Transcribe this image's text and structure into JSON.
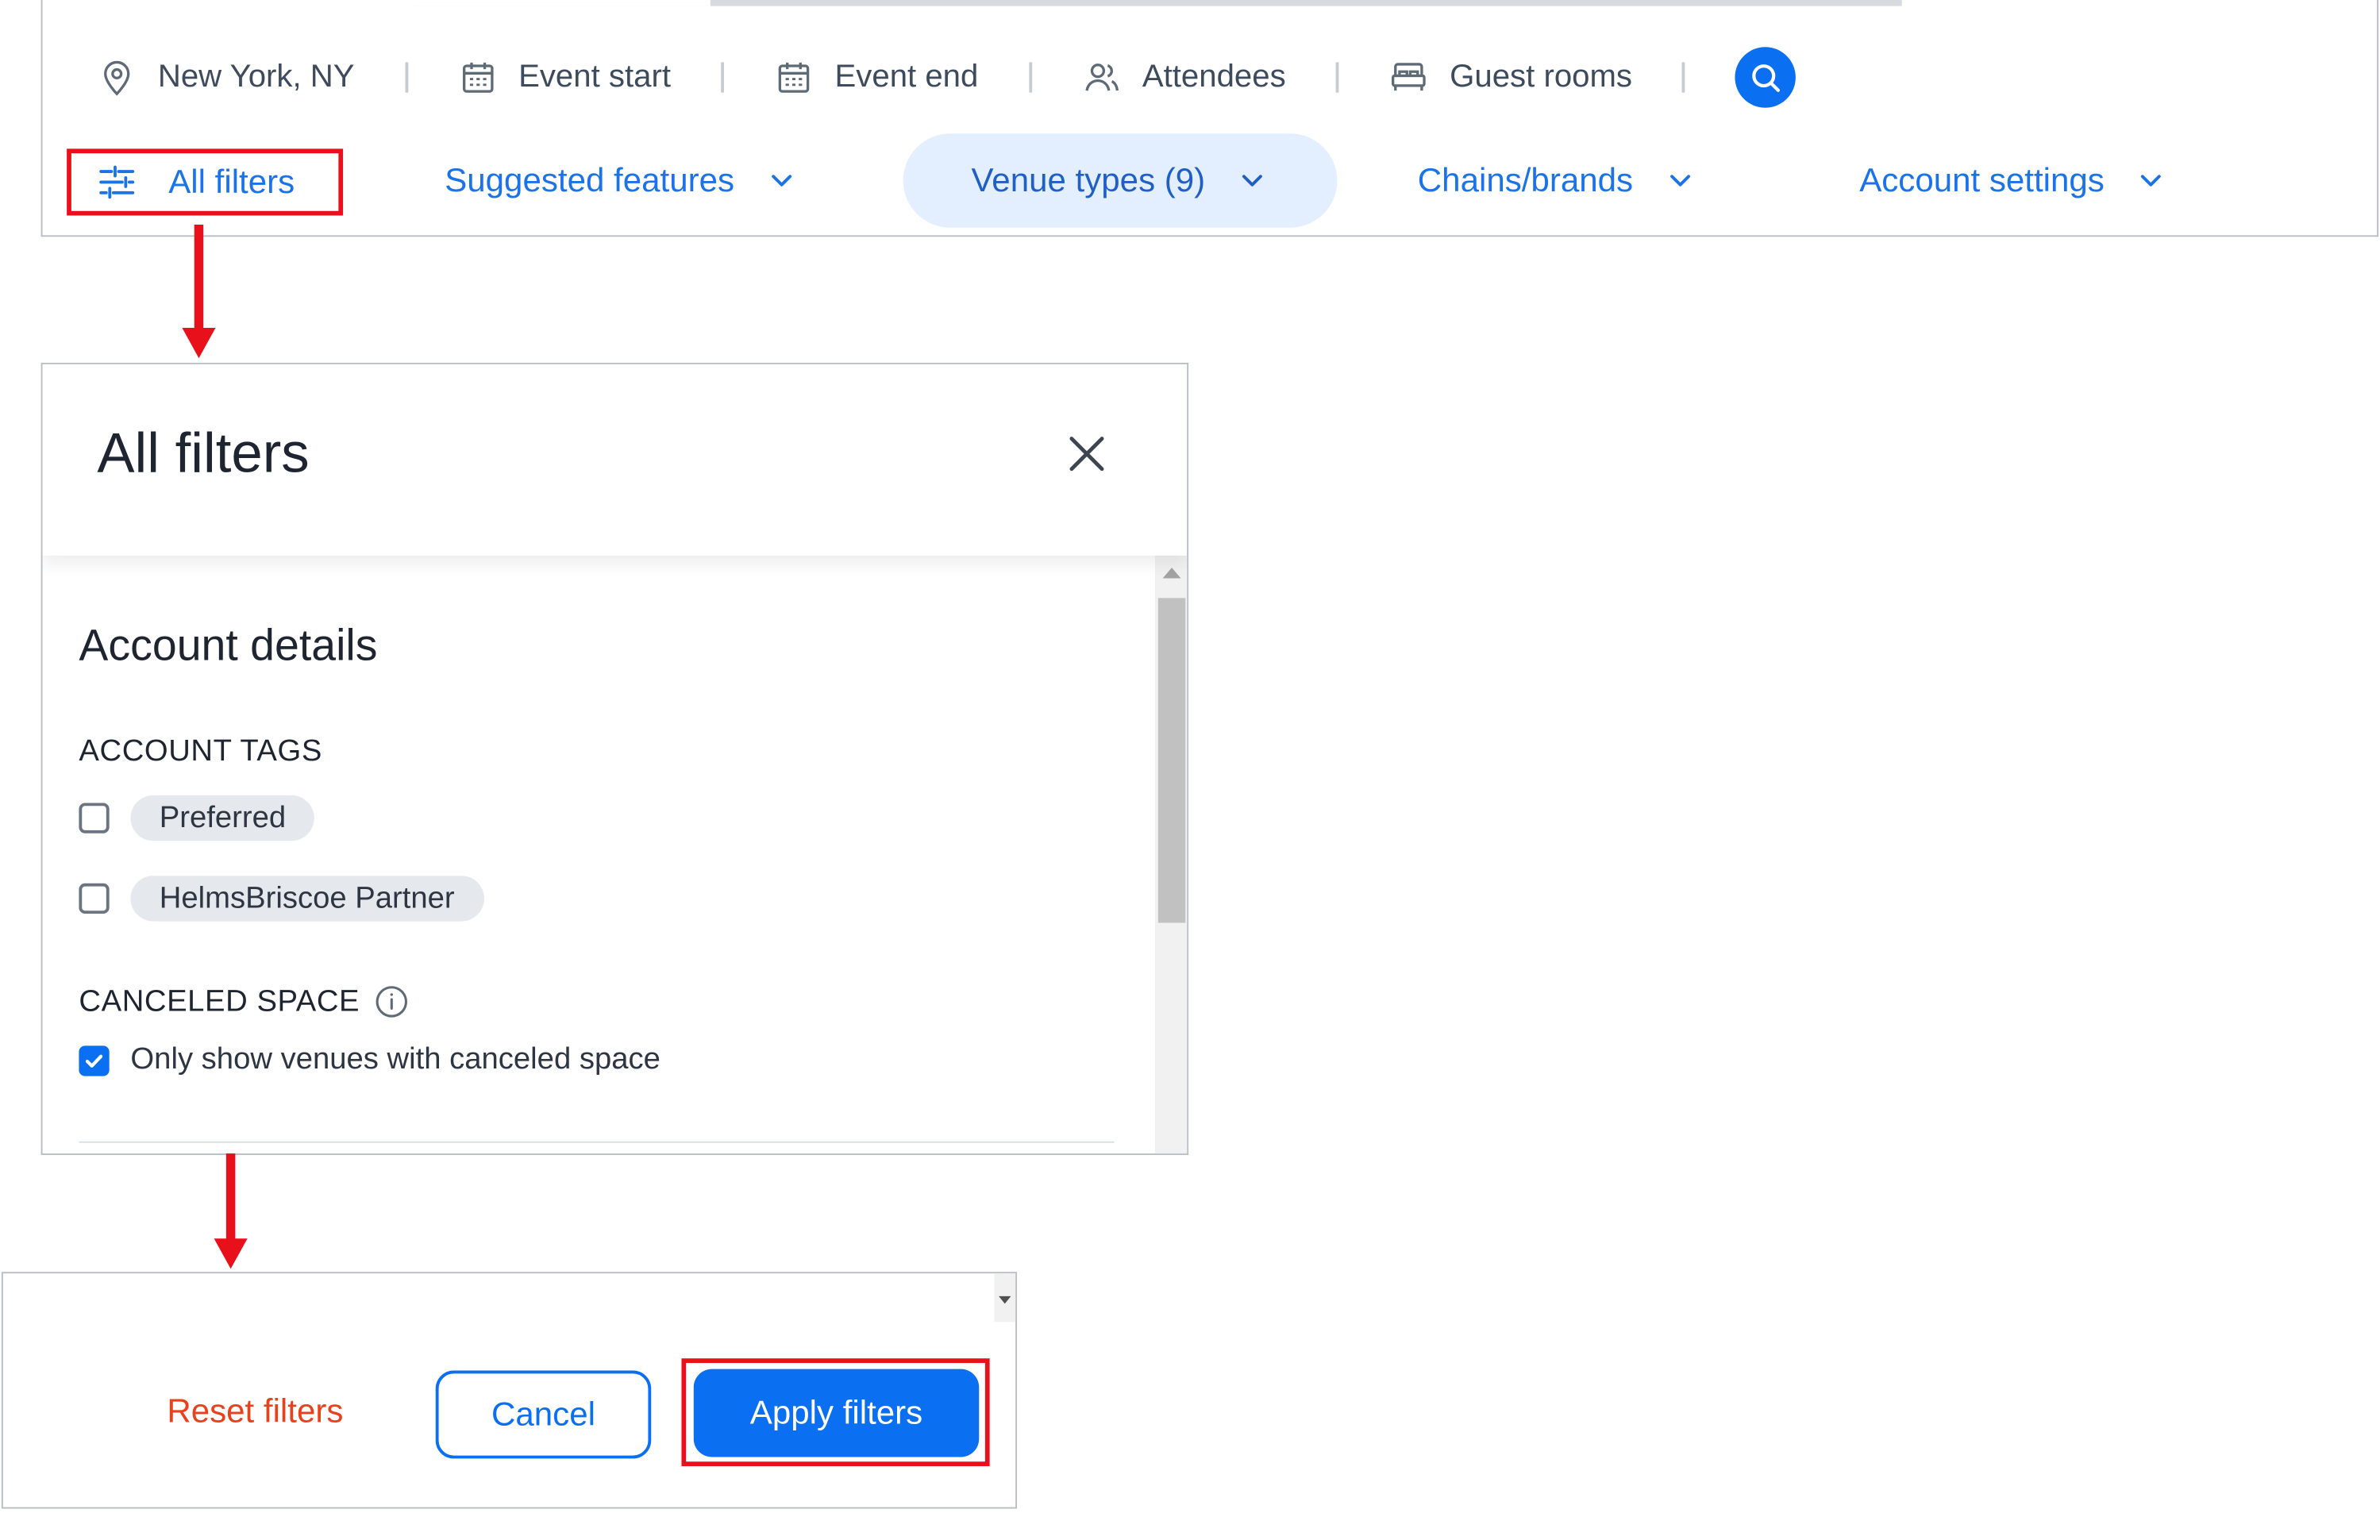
{
  "search_bar": {
    "location": "New York, NY",
    "event_start": "Event start",
    "event_end": "Event end",
    "attendees": "Attendees",
    "guest_rooms": "Guest rooms"
  },
  "filter_bar": {
    "all_filters": "All filters",
    "suggested_features": "Suggested features",
    "venue_types": "Venue types (9)",
    "chains_brands": "Chains/brands",
    "account_settings": "Account settings"
  },
  "modal": {
    "title": "All filters",
    "section_title": "Account details",
    "account_tags_label": "ACCOUNT TAGS",
    "tags": [
      {
        "label": "Preferred",
        "checked": false
      },
      {
        "label": "HelmsBriscoe Partner",
        "checked": false
      }
    ],
    "canceled_space_label": "CANCELED SPACE",
    "canceled_space_option": "Only show venues with canceled space",
    "canceled_space_checked": true
  },
  "footer": {
    "reset_label": "Reset filters",
    "cancel_label": "Cancel",
    "apply_label": "Apply filters"
  },
  "colors": {
    "accent": "#0b6ff2",
    "highlight_box": "#e8111b",
    "reset_text": "#e8411b",
    "chip_selected_bg": "#e3efff"
  }
}
